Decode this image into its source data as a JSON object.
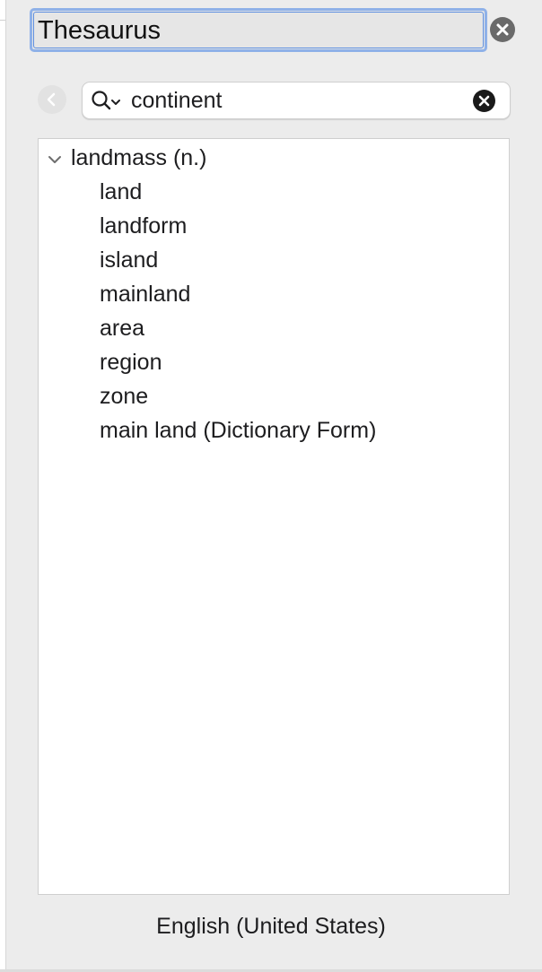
{
  "panel": {
    "title": "Thesaurus"
  },
  "search": {
    "query": "continent"
  },
  "results": {
    "group": {
      "label": "landmass (n.)",
      "expanded": true,
      "synonyms": [
        "land",
        "landform",
        "island",
        "mainland",
        "area",
        "region",
        "zone",
        "main land (Dictionary Form)"
      ]
    }
  },
  "footer": {
    "language": "English (United States)"
  },
  "icons": {
    "title_close": "close-circle-icon",
    "back": "chevron-left-icon",
    "search": "magnifier-dropdown-icon",
    "clear": "clear-circle-icon",
    "disclosure": "chevron-down-icon"
  },
  "colors": {
    "focus_ring": "#8fb1e8",
    "panel_bg": "#ececec"
  }
}
